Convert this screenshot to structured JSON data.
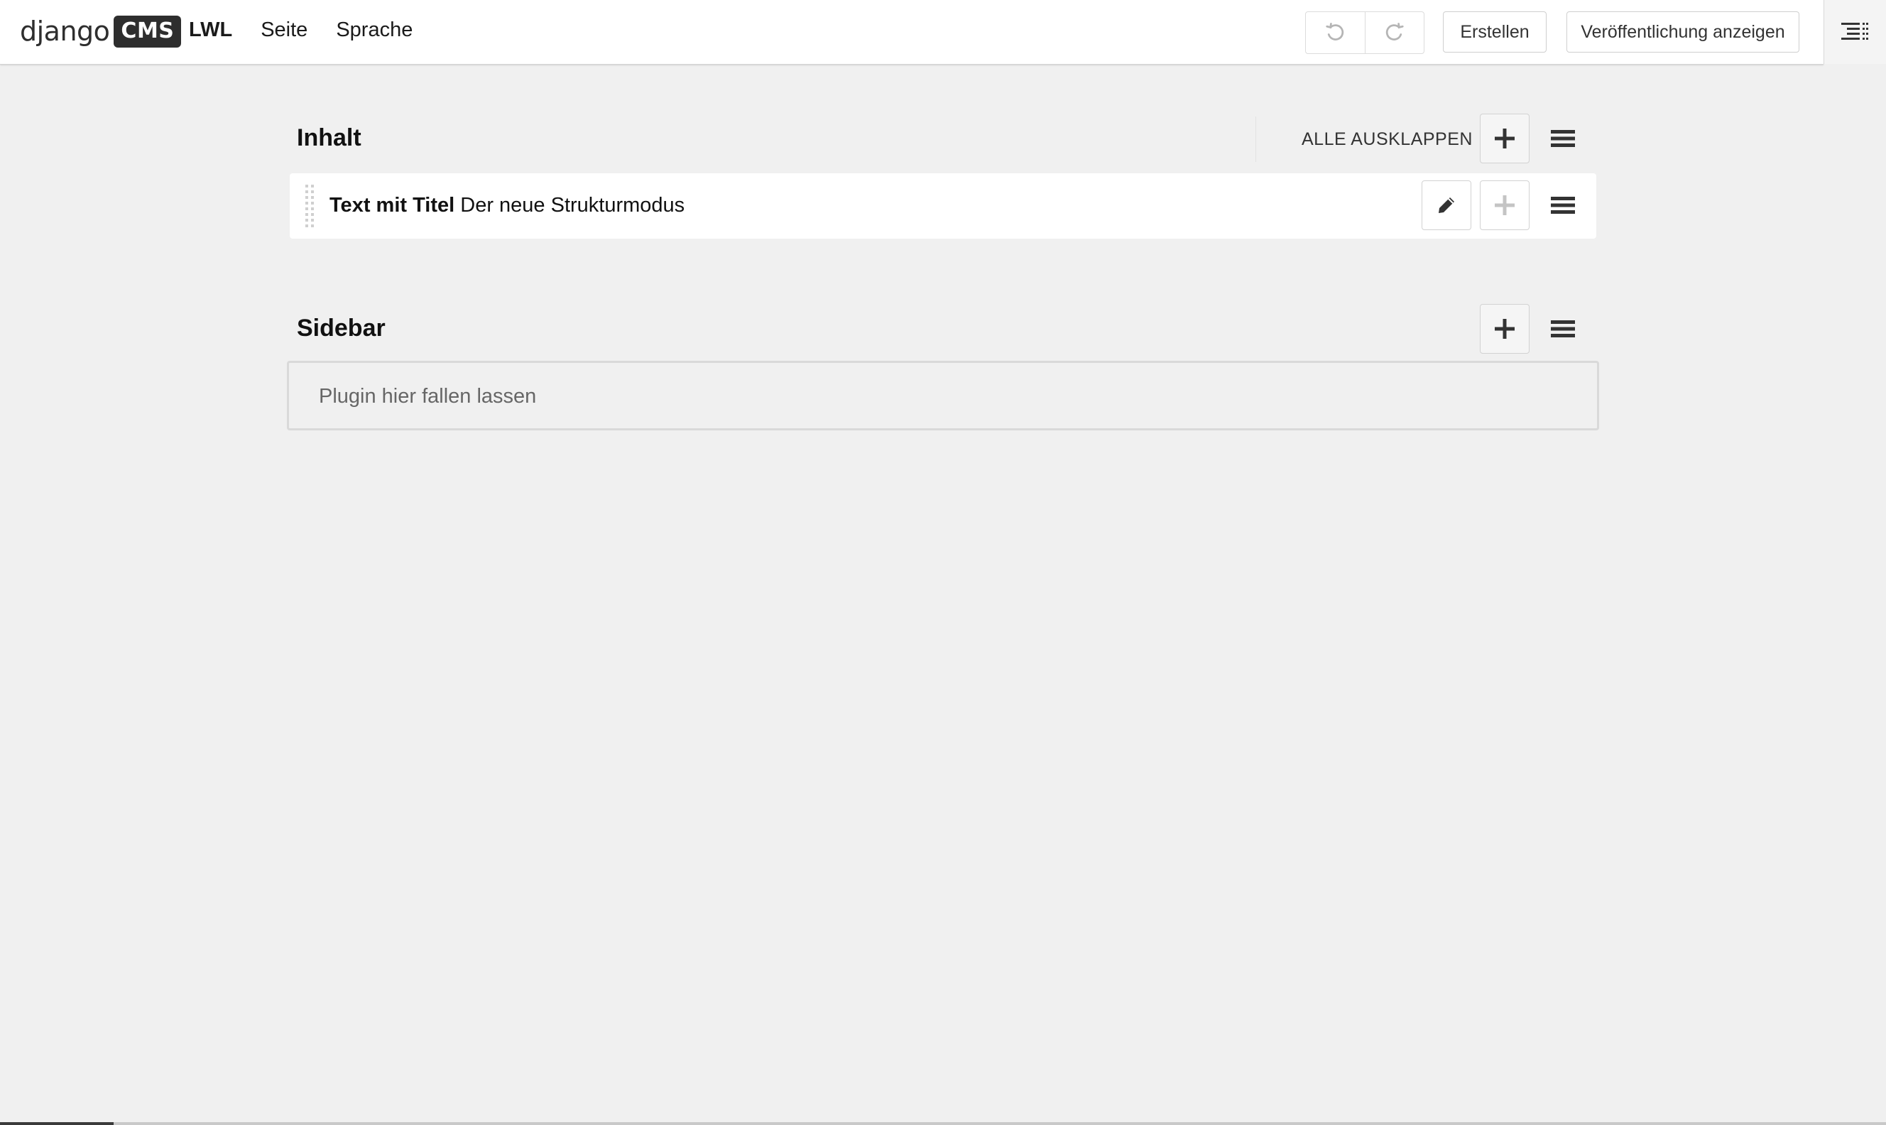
{
  "toolbar": {
    "logo_text": "django",
    "logo_badge": "CMS",
    "menu": [
      {
        "label": "LWL"
      },
      {
        "label": "Seite"
      },
      {
        "label": "Sprache"
      }
    ],
    "create_label": "Erstellen",
    "publish_label": "Veröffentlichung anzeigen",
    "icons": {
      "undo": "undo-icon",
      "redo": "redo-icon",
      "structure": "structure-mode-icon"
    }
  },
  "structure": {
    "placeholders": [
      {
        "title": "Inhalt",
        "expand_all_label": "ALLE AUSKLAPPEN",
        "plugins": [
          {
            "type": "Text mit Titel",
            "title": "Der neue Strukturmodus"
          }
        ]
      },
      {
        "title": "Sidebar",
        "empty_text": "Plugin hier fallen lassen"
      }
    ]
  },
  "colors": {
    "background": "#f0f0f0",
    "toolbar": "#ffffff",
    "logo_badge": "#2e2e2e"
  }
}
